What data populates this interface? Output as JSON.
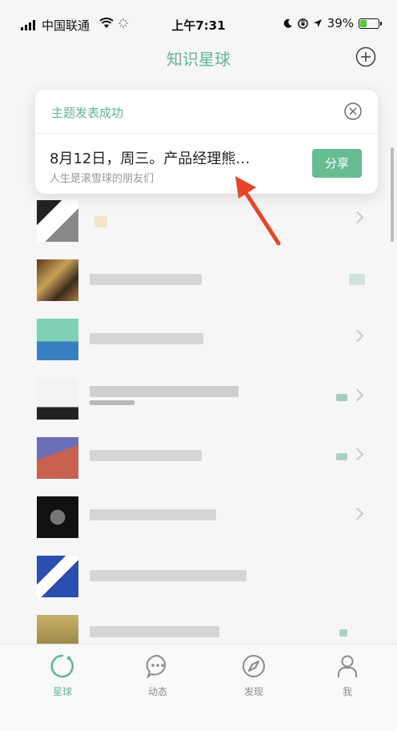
{
  "status_bar": {
    "carrier": "中国联通",
    "time": "上午7:31",
    "battery": "39%",
    "battery_level": 0.39
  },
  "header": {
    "title": "知识星球"
  },
  "popup": {
    "title": "主题发表成功",
    "headline": "8月12日，周三。产品经理熊…",
    "subtitle": "人生是滚雪球的朋友们",
    "share_label": "分享"
  },
  "tabs": [
    {
      "label": "星球",
      "icon": "planet-icon",
      "active": true
    },
    {
      "label": "动态",
      "icon": "chat-bubble-icon",
      "active": false
    },
    {
      "label": "发现",
      "icon": "compass-icon",
      "active": false
    },
    {
      "label": "我",
      "icon": "person-icon",
      "active": false
    }
  ],
  "colors": {
    "accent": "#5fb894",
    "share_button": "#67bc94",
    "arrow": "#e8442b"
  }
}
